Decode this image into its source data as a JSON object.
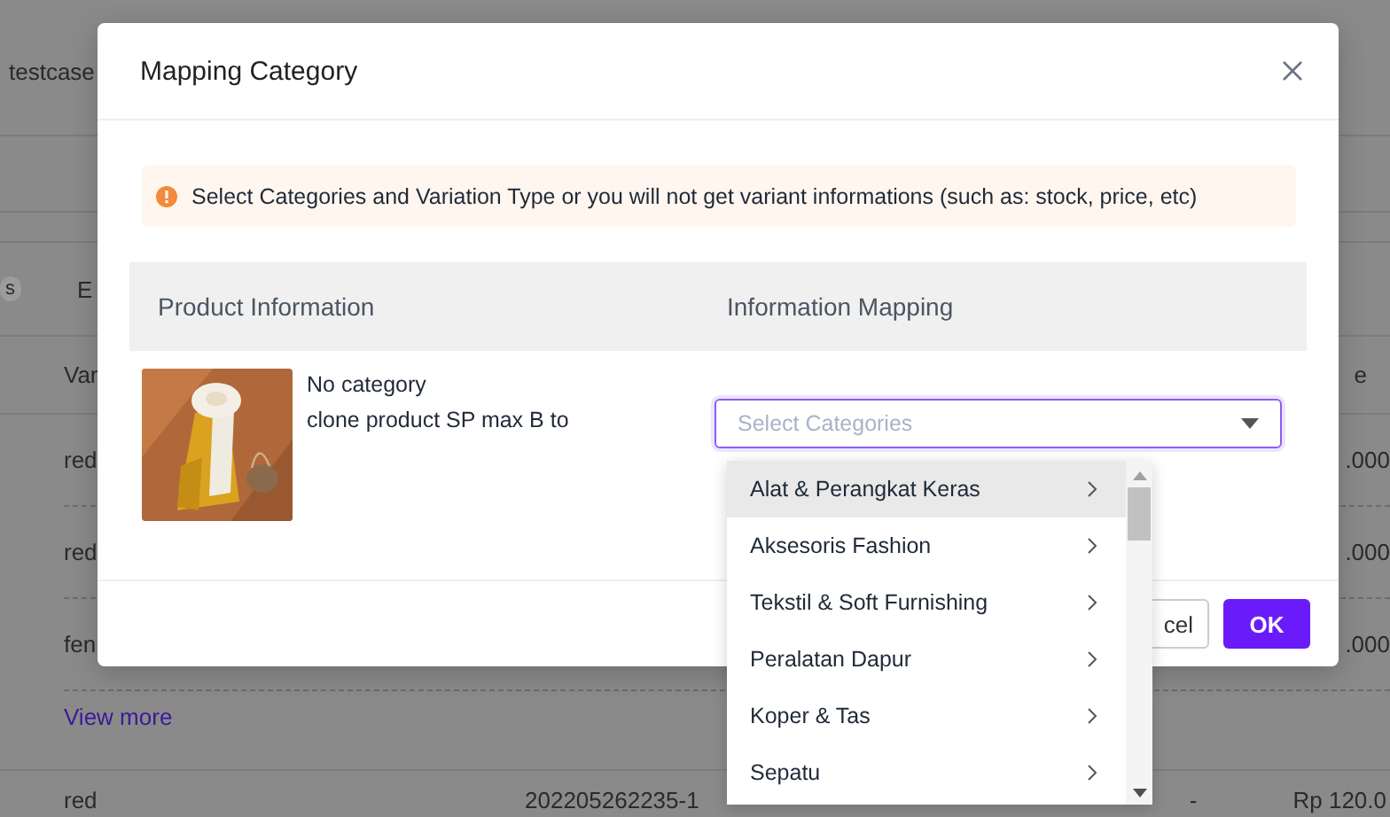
{
  "background": {
    "header_text": "testcase",
    "chips": [
      "s",
      "E"
    ],
    "table_header": [
      "Var",
      "e"
    ],
    "rows": [
      {
        "variant": "red",
        "price": ".000"
      },
      {
        "variant": "red",
        "price": ".000"
      },
      {
        "variant": "fen",
        "price": ".000"
      }
    ],
    "view_more": "View more",
    "next_row": {
      "variant": "red",
      "sku": "202205262235-1",
      "dash": "-",
      "price": "Rp 120.0"
    }
  },
  "modal": {
    "title": "Mapping Category",
    "alert": "Select Categories and Variation Type or you will not get variant informations (such as: stock, price, etc)",
    "columns": [
      "Product Information",
      "Information Mapping"
    ],
    "product": {
      "category": "No category",
      "name": "clone product SP max B to"
    },
    "select": {
      "placeholder": "Select Categories"
    },
    "buttons": [
      {
        "label": "cel",
        "kind": "secondary"
      },
      {
        "label": "OK",
        "kind": "primary"
      }
    ]
  },
  "dropdown": {
    "items": [
      {
        "label": "Alat & Perangkat Keras",
        "highlighted": true
      },
      {
        "label": "Aksesoris Fashion",
        "highlighted": false
      },
      {
        "label": "Tekstil & Soft Furnishing",
        "highlighted": false
      },
      {
        "label": "Peralatan Dapur",
        "highlighted": false
      },
      {
        "label": "Koper & Tas",
        "highlighted": false
      },
      {
        "label": "Sepatu",
        "highlighted": false
      }
    ]
  }
}
